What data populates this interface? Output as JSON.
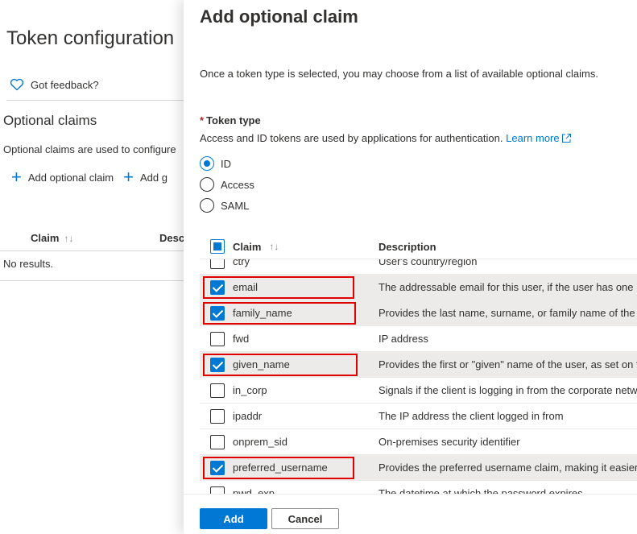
{
  "background": {
    "title": "Token configuration",
    "feedback": "Got feedback?",
    "section_title": "Optional claims",
    "section_desc": "Optional claims are used to configure",
    "commands": [
      {
        "label": "Add optional claim",
        "icon": "plus-icon"
      },
      {
        "label": "Add g",
        "icon": "plus-icon"
      }
    ],
    "table_headers": [
      "Claim",
      "Descr"
    ],
    "sort_icon": "↑↓",
    "empty_text": "No results."
  },
  "panel": {
    "title": "Add optional claim",
    "intro": "Once a token type is selected, you may choose from a list of available optional claims.",
    "token_type": {
      "required_mark": "*",
      "label": "Token type",
      "description": "Access and ID tokens are used by applications for authentication.",
      "learn_more": "Learn more",
      "options": [
        {
          "label": "ID",
          "checked": true
        },
        {
          "label": "Access",
          "checked": false
        },
        {
          "label": "SAML",
          "checked": false
        }
      ]
    },
    "table": {
      "header_claim": "Claim",
      "sort_icon": "↑↓",
      "header_description": "Description",
      "rows": [
        {
          "claim": "ctry",
          "description": "User's country/region",
          "checked": false,
          "highlighted": false
        },
        {
          "claim": "email",
          "description": "The addressable email for this user, if the user has one",
          "checked": true,
          "highlighted": true
        },
        {
          "claim": "family_name",
          "description": "Provides the last name, surname, or family name of the user",
          "checked": true,
          "highlighted": true
        },
        {
          "claim": "fwd",
          "description": "IP address",
          "checked": false,
          "highlighted": false
        },
        {
          "claim": "given_name",
          "description": "Provides the first or \"given\" name of the user, as set on the user object",
          "checked": true,
          "highlighted": true
        },
        {
          "claim": "in_corp",
          "description": "Signals if the client is logging in from the corporate network",
          "checked": false,
          "highlighted": false
        },
        {
          "claim": "ipaddr",
          "description": "The IP address the client logged in from",
          "checked": false,
          "highlighted": false
        },
        {
          "claim": "onprem_sid",
          "description": "On-premises security identifier",
          "checked": false,
          "highlighted": false
        },
        {
          "claim": "preferred_username",
          "description": "Provides the preferred username claim, making it easier for apps",
          "checked": true,
          "highlighted": true
        },
        {
          "claim": "pwd_exp",
          "description": "The datetime at which the password expires",
          "checked": false,
          "highlighted": false
        }
      ]
    },
    "buttons": {
      "add": "Add",
      "cancel": "Cancel"
    }
  },
  "colors": {
    "accent": "#0078d4",
    "highlight": "#e00000",
    "selected_row": "#edebe9"
  }
}
